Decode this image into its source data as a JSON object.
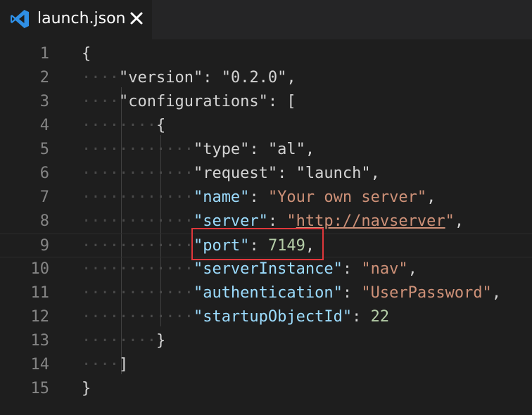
{
  "tab": {
    "filename": "launch.json",
    "icon": "vscode-icon",
    "close_icon": "close-icon"
  },
  "colors": {
    "background": "#1e1e1e",
    "line_number": "#858585",
    "key": "#9cdcfe",
    "string": "#ce9178",
    "number": "#b5cea8",
    "punctuation": "#d4d4d4",
    "highlight_border": "#e0373b",
    "vscode_blue": "#2f8fe5"
  },
  "editor": {
    "lines": [
      {
        "n": "1",
        "ws": "",
        "tokens": [
          {
            "t": "{",
            "c": "punc"
          }
        ]
      },
      {
        "n": "2",
        "ws": "····",
        "tokens": [
          {
            "t": "\"version\"",
            "c": "key-dim"
          },
          {
            "t": ": ",
            "c": "punc"
          },
          {
            "t": "\"0.2.0\"",
            "c": "key-dim"
          },
          {
            "t": ",",
            "c": "punc"
          }
        ]
      },
      {
        "n": "3",
        "ws": "····",
        "tokens": [
          {
            "t": "\"configurations\"",
            "c": "key-dim"
          },
          {
            "t": ": [",
            "c": "punc"
          }
        ]
      },
      {
        "n": "4",
        "ws": "········",
        "tokens": [
          {
            "t": "{",
            "c": "punc"
          }
        ]
      },
      {
        "n": "5",
        "ws": "············",
        "tokens": [
          {
            "t": "\"type\"",
            "c": "key-dim"
          },
          {
            "t": ": ",
            "c": "punc"
          },
          {
            "t": "\"al\"",
            "c": "key-dim"
          },
          {
            "t": ",",
            "c": "punc"
          }
        ]
      },
      {
        "n": "6",
        "ws": "············",
        "tokens": [
          {
            "t": "\"request\"",
            "c": "key-dim"
          },
          {
            "t": ": ",
            "c": "punc"
          },
          {
            "t": "\"launch\"",
            "c": "key-dim"
          },
          {
            "t": ",",
            "c": "punc"
          }
        ]
      },
      {
        "n": "7",
        "ws": "············",
        "tokens": [
          {
            "t": "\"name\"",
            "c": "key"
          },
          {
            "t": ": ",
            "c": "punc"
          },
          {
            "t": "\"Your own server\"",
            "c": "str"
          },
          {
            "t": ",",
            "c": "punc"
          }
        ]
      },
      {
        "n": "8",
        "ws": "············",
        "tokens": [
          {
            "t": "\"server\"",
            "c": "key"
          },
          {
            "t": ": ",
            "c": "punc"
          },
          {
            "t": "\"",
            "c": "str"
          },
          {
            "t": "http://navserver",
            "c": "link"
          },
          {
            "t": "\"",
            "c": "str"
          },
          {
            "t": ",",
            "c": "punc"
          }
        ]
      },
      {
        "n": "9",
        "ws": "············",
        "tokens": [
          {
            "t": "\"port\"",
            "c": "key"
          },
          {
            "t": ": ",
            "c": "punc"
          },
          {
            "t": "7149",
            "c": "num"
          },
          {
            "t": ",",
            "c": "punc"
          }
        ]
      },
      {
        "n": "10",
        "ws": "············",
        "tokens": [
          {
            "t": "\"serverInstance\"",
            "c": "key"
          },
          {
            "t": ": ",
            "c": "punc"
          },
          {
            "t": "\"nav\"",
            "c": "str"
          },
          {
            "t": ",",
            "c": "punc"
          }
        ]
      },
      {
        "n": "11",
        "ws": "············",
        "tokens": [
          {
            "t": "\"authentication\"",
            "c": "key"
          },
          {
            "t": ": ",
            "c": "punc"
          },
          {
            "t": "\"UserPassword\"",
            "c": "str"
          },
          {
            "t": ",",
            "c": "punc"
          }
        ]
      },
      {
        "n": "12",
        "ws": "············",
        "tokens": [
          {
            "t": "\"startupObjectId\"",
            "c": "key"
          },
          {
            "t": ": ",
            "c": "punc"
          },
          {
            "t": "22",
            "c": "num"
          }
        ]
      },
      {
        "n": "13",
        "ws": "········",
        "tokens": [
          {
            "t": "}",
            "c": "punc"
          }
        ]
      },
      {
        "n": "14",
        "ws": "····",
        "tokens": [
          {
            "t": "]",
            "c": "punc"
          }
        ]
      },
      {
        "n": "15",
        "ws": "",
        "tokens": [
          {
            "t": "}",
            "c": "punc"
          }
        ]
      }
    ],
    "highlighted_line": "9"
  }
}
